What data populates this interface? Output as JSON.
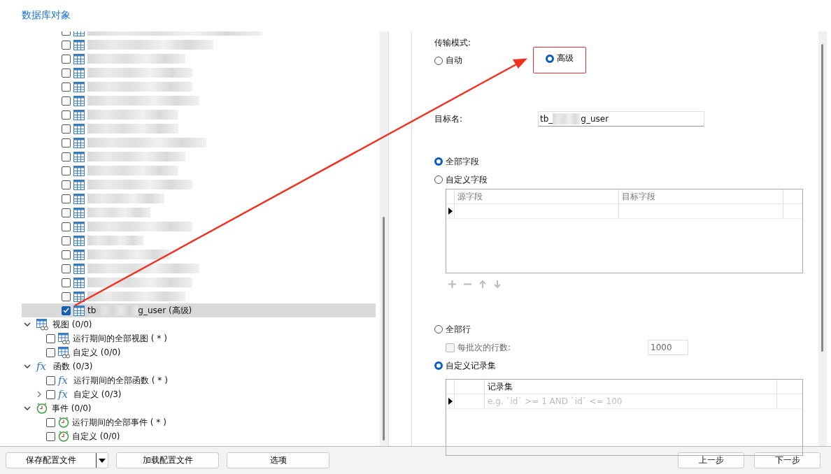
{
  "section_title": "数据库对象",
  "tree": {
    "tables": [
      {
        "checked": false,
        "selected": false
      },
      {
        "checked": false,
        "selected": false
      },
      {
        "checked": false,
        "selected": false
      },
      {
        "checked": false,
        "selected": false
      },
      {
        "checked": false,
        "selected": false
      },
      {
        "checked": false,
        "selected": false
      },
      {
        "checked": false,
        "selected": false
      },
      {
        "checked": false,
        "selected": false
      },
      {
        "checked": false,
        "selected": false
      },
      {
        "checked": false,
        "selected": false
      },
      {
        "checked": false,
        "selected": false
      },
      {
        "checked": false,
        "selected": false
      },
      {
        "checked": false,
        "selected": false
      },
      {
        "checked": false,
        "selected": false
      },
      {
        "checked": false,
        "selected": false
      },
      {
        "checked": false,
        "selected": false
      },
      {
        "checked": false,
        "selected": false
      },
      {
        "checked": false,
        "selected": false
      },
      {
        "checked": false,
        "selected": false
      },
      {
        "checked": false,
        "selected": false
      },
      {
        "checked": true,
        "selected": true,
        "label_start": "tb",
        "label_end": "g_user (高级)"
      }
    ],
    "groups": [
      {
        "kind": "view",
        "label": "视图 (0/0)",
        "expanded": true,
        "children": [
          {
            "label": "运行期间的全部视图 ( * )",
            "checked": false
          },
          {
            "label": "自定义 (0/0)",
            "checked": false
          }
        ]
      },
      {
        "kind": "function",
        "icon_glyph": "fx",
        "label": "函数 (0/3)",
        "expanded": true,
        "children": [
          {
            "label": "运行期间的全部函数 ( * )",
            "checked": false,
            "icon_glyph": "fx"
          },
          {
            "label": "自定义 (0/3)",
            "checked": false,
            "expanded": false,
            "icon_glyph": "fx"
          }
        ]
      },
      {
        "kind": "event",
        "label": "事件 (0/0)",
        "expanded": true,
        "children": [
          {
            "label": "运行期间的全部事件 ( * )",
            "checked": false
          },
          {
            "label": "自定义 (0/0)",
            "checked": false
          }
        ]
      }
    ]
  },
  "transfer_mode": {
    "label": "传输模式:",
    "options": [
      {
        "label": "自动",
        "selected": false,
        "highlighted": false
      },
      {
        "label": "高级",
        "selected": true,
        "highlighted": true
      }
    ]
  },
  "target_name": {
    "label": "目标名:",
    "value_start": "tb_",
    "value_end": "g_user"
  },
  "fields": {
    "options": [
      {
        "label": "全部字段",
        "selected": true
      },
      {
        "label": "自定义字段",
        "selected": false
      }
    ],
    "columns": [
      "源字段",
      "目标字段"
    ]
  },
  "rows": {
    "all_rows": {
      "label": "全部行",
      "selected": false
    },
    "batch": {
      "label": "每批次的行数:",
      "checked": false,
      "disabled": true,
      "value": "1000"
    },
    "custom": {
      "label": "自定义记录集",
      "selected": true
    },
    "columns": [
      "记录集"
    ],
    "placeholder": "e.g. `id` >= 1 AND `id` <= 100"
  },
  "footer": {
    "buttons": [
      "保存配置文件",
      "加载配置文件",
      "选项"
    ],
    "nav": [
      "上一步",
      "下一步"
    ]
  }
}
